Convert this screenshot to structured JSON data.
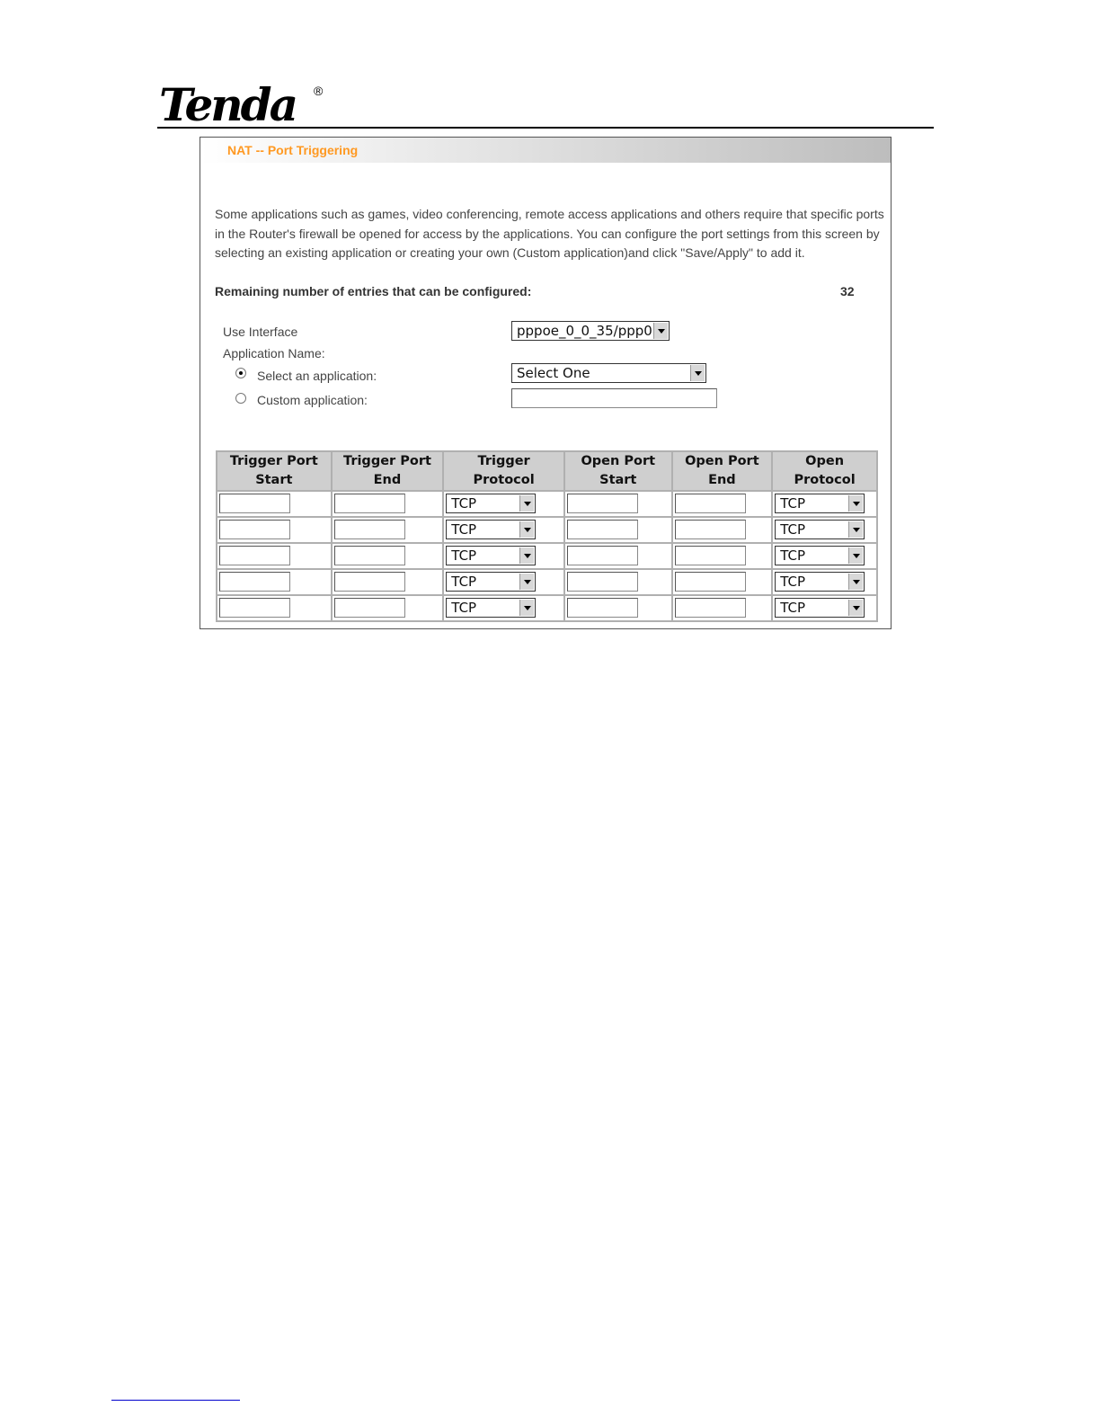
{
  "doc": {
    "logo_text": "Tenda",
    "logo_reg": "®"
  },
  "page": {
    "title": "NAT -- Port Triggering",
    "intro": "Some applications such as games, video conferencing, remote access applications and others require that specific ports in the Router's firewall be opened for access by the applications. You can configure the port settings from this screen by selecting an existing application or creating your own (Custom application)and click \"Save/Apply\" to add it.",
    "remaining_label": "Remaining number of entries that can be configured:",
    "remaining_value": "32"
  },
  "form": {
    "use_interface_label": "Use Interface",
    "use_interface_value": "pppoe_0_0_35/ppp0",
    "app_name_label": "Application Name:",
    "select_app_label": "Select an application:",
    "select_app_value": "Select One",
    "custom_app_label": "Custom application:",
    "custom_app_value": "",
    "selected_option": "select"
  },
  "table": {
    "headers": {
      "trigger_start": [
        "Trigger Port",
        "Start"
      ],
      "trigger_end": [
        "Trigger Port",
        "End"
      ],
      "trigger_protocol": "Trigger Protocol",
      "open_start": [
        "Open Port",
        "Start"
      ],
      "open_end": [
        "Open Port",
        "End"
      ],
      "open_protocol": [
        "Open",
        "Protocol"
      ]
    },
    "rows": [
      {
        "trigger_start": "",
        "trigger_end": "",
        "trigger_protocol": "TCP",
        "open_start": "",
        "open_end": "",
        "open_protocol": "TCP"
      },
      {
        "trigger_start": "",
        "trigger_end": "",
        "trigger_protocol": "TCP",
        "open_start": "",
        "open_end": "",
        "open_protocol": "TCP"
      },
      {
        "trigger_start": "",
        "trigger_end": "",
        "trigger_protocol": "TCP",
        "open_start": "",
        "open_end": "",
        "open_protocol": "TCP"
      },
      {
        "trigger_start": "",
        "trigger_end": "",
        "trigger_protocol": "TCP",
        "open_start": "",
        "open_end": "",
        "open_protocol": "TCP"
      },
      {
        "trigger_start": "",
        "trigger_end": "",
        "trigger_protocol": "TCP",
        "open_start": "",
        "open_end": "",
        "open_protocol": "TCP"
      }
    ]
  },
  "colors": {
    "title_accent": "#ff9922",
    "header_bg": "#cfcfcf"
  }
}
